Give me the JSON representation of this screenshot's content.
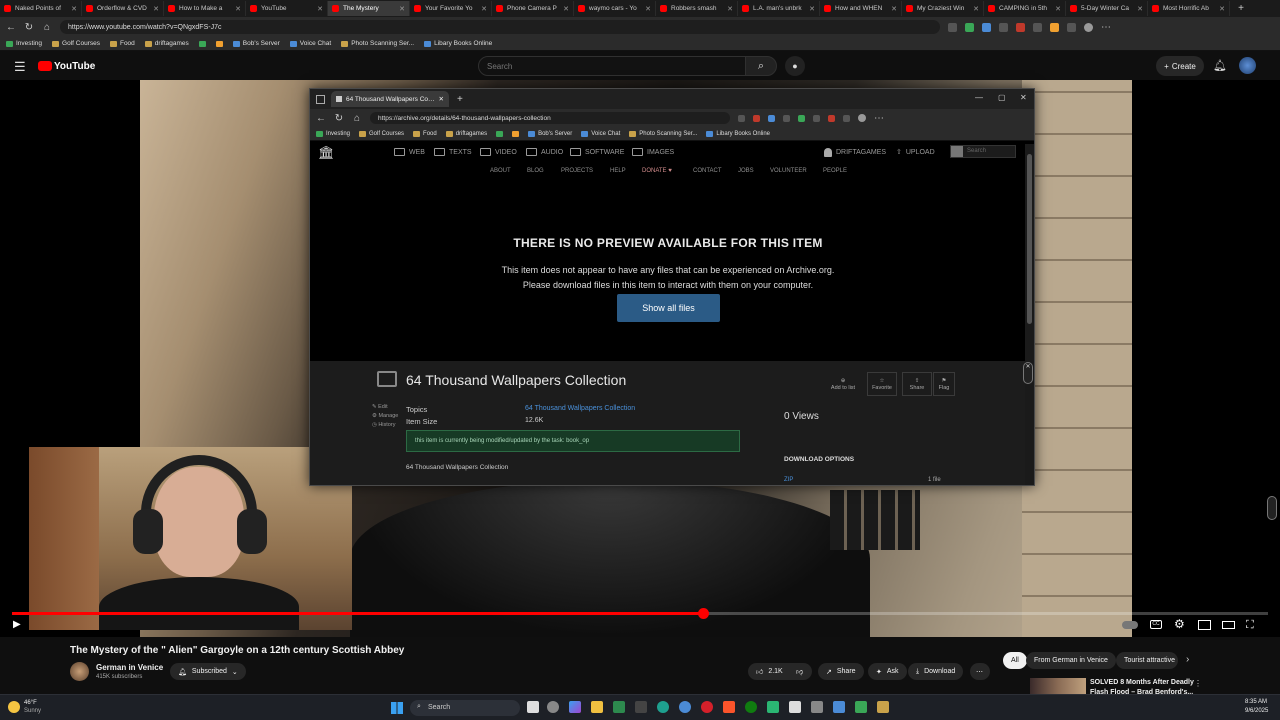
{
  "browser": {
    "tabs": [
      {
        "title": "Naked Points of"
      },
      {
        "title": "Orderflow & CVD"
      },
      {
        "title": "How to Make a"
      },
      {
        "title": "YouTube"
      },
      {
        "title": "The Mystery"
      },
      {
        "title": "Your Favorite Yo"
      },
      {
        "title": "Phone Camera P"
      },
      {
        "title": "waymo cars - Yo"
      },
      {
        "title": "Robbers smash"
      },
      {
        "title": "L.A. man's unbrk"
      },
      {
        "title": "How and WHEN"
      },
      {
        "title": "My Craziest Win"
      },
      {
        "title": "CAMPING in 5th"
      },
      {
        "title": "5-Day Winter Ca"
      },
      {
        "title": "Most Horrific Ab"
      }
    ],
    "url": "https://www.youtube.com/watch?v=QNgxdFS-J7c",
    "bookmarks": [
      "Investing",
      "Golf Courses",
      "Food",
      "driftagames",
      "Bob's Server",
      "Voice Chat",
      "Photo Scanning Ser...",
      "Libary Books Online"
    ]
  },
  "youtube": {
    "logo": "YouTube",
    "search_placeholder": "Search",
    "create_label": "Create"
  },
  "popup": {
    "tab_title": "64 Thousand Wallpapers Collecti",
    "url": "https://archive.org/details/64-thousand-wallpapers-collection",
    "bookmarks": [
      "Investing",
      "Golf Courses",
      "Food",
      "driftagames",
      "Bob's Server",
      "Voice Chat",
      "Photo Scanning Ser...",
      "Libary Books Online"
    ],
    "media_nav": [
      "WEB",
      "TEXTS",
      "VIDEO",
      "AUDIO",
      "SOFTWARE",
      "IMAGES"
    ],
    "user": "DRIFTAGAMES",
    "upload": "UPLOAD",
    "search_placeholder": "Search",
    "sub_nav": [
      "ABOUT",
      "BLOG",
      "PROJECTS",
      "HELP",
      "DONATE ♥",
      "CONTACT",
      "JOBS",
      "VOLUNTEER",
      "PEOPLE"
    ],
    "preview_title": "THERE IS NO PREVIEW AVAILABLE FOR THIS ITEM",
    "preview_line1": "This item does not appear to have any files that can be experienced on Archive.org.",
    "preview_line2": "Please download files in this item to interact with them on your computer.",
    "show_all_files": "Show all files",
    "item_title": "64 Thousand Wallpapers Collection",
    "actions": [
      "Add to list",
      "Favorite",
      "Share",
      "Flag"
    ],
    "side_links": [
      "Edit",
      "Manage",
      "History"
    ],
    "topics_label": "Topics",
    "topics_value": "64 Thousand Wallpapers Collection",
    "size_label": "Item Size",
    "size_value": "12.6K",
    "notice": "this item is currently being modified/updated by the task: book_op",
    "description": "64 Thousand Wallpapers Collection",
    "views": "0 Views",
    "download_options": "DOWNLOAD OPTIONS",
    "zip_label": "ZIP",
    "zip_count": "1 file"
  },
  "player": {
    "progress_fraction": 0.55
  },
  "video": {
    "title": "The Mystery of the \" Alien\" Gargoyle on a 12th century Scottish Abbey",
    "channel": "German in Venice",
    "subscribers": "415K subscribers",
    "subscribed_label": "Subscribed",
    "likes": "2.1K",
    "share": "Share",
    "ask": "Ask",
    "download": "Download",
    "chips": [
      "All",
      "From German in Venice",
      "Tourist attractive"
    ],
    "rec_title_1": "SOLVED 8 Months After Deadly",
    "rec_title_2": "Flash Flood – Brad Benford's..."
  },
  "taskbar": {
    "weather_temp": "46°F",
    "weather_desc": "Sunny",
    "search": "Search",
    "time": "8:35 AM",
    "date": "9/6/2025"
  }
}
